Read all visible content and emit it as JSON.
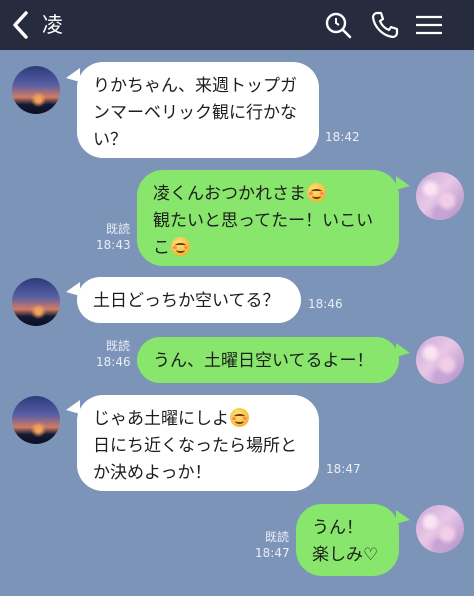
{
  "header": {
    "contact_name": "凌",
    "icons": [
      "back-chevron-icon",
      "search-icon",
      "phone-icon",
      "menu-icon"
    ],
    "background": "#262b3e"
  },
  "colors": {
    "chat_background": "#7d94b9",
    "incoming_bubble": "#ffffff",
    "outgoing_bubble": "#87e66b"
  },
  "messages": [
    {
      "direction": "incoming",
      "lines": [
        "りかちゃん、来週トップガ",
        "ンマーベリック観に行かな",
        "い？"
      ],
      "time": "18:42"
    },
    {
      "direction": "outgoing",
      "lines": [
        "凌くんおつかれさま",
        "観たいと思ってたー！いこい",
        "こ"
      ],
      "emoji": "smiling-face-icon",
      "read": "既読",
      "time": "18:43"
    },
    {
      "direction": "incoming",
      "lines": [
        "土日どっちか空いてる？"
      ],
      "time": "18:46"
    },
    {
      "direction": "outgoing",
      "lines": [
        "うん、土曜日空いてるよー！"
      ],
      "read": "既読",
      "time": "18:46"
    },
    {
      "direction": "incoming",
      "lines": [
        "じゃあ土曜にしよ",
        "日にち近くなったら場所と",
        "か決めよっか！"
      ],
      "emoji": "smiling-face-icon",
      "time": "18:47"
    },
    {
      "direction": "outgoing",
      "lines": [
        "うん！",
        "楽しみ♡"
      ],
      "read": "既読",
      "time": "18:47"
    }
  ]
}
